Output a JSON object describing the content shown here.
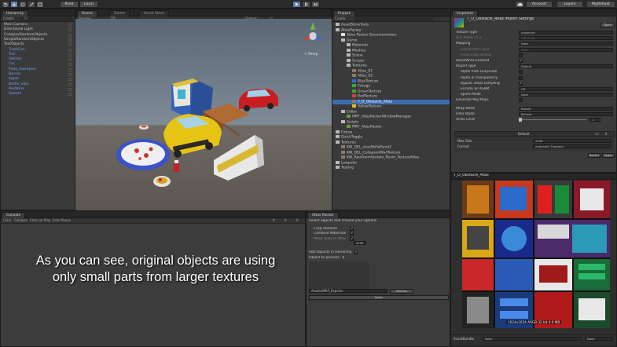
{
  "toolbar": {
    "pivot": "Pivot",
    "local": "Local",
    "account": "Account",
    "layers": "Layers",
    "layout": "MyDefault"
  },
  "hierarchy": {
    "tab": "Hierarchy",
    "create": "Create",
    "search_placeholder": "All",
    "items": [
      {
        "label": "Main Camera",
        "style": ""
      },
      {
        "label": "Directional Light",
        "style": ""
      },
      {
        "label": "ComplexRandomObjects",
        "style": ""
      },
      {
        "label": "SimpleRandomObjects",
        "style": ""
      },
      {
        "label": "TestObjects",
        "style": ""
      },
      {
        "label": "TrashCan",
        "style": "blue"
      },
      {
        "label": "Taxi",
        "style": "blue"
      },
      {
        "label": "Vehicle",
        "style": "blue"
      },
      {
        "label": "Car",
        "style": "blue"
      },
      {
        "label": "Plate_Sweepers",
        "style": "blue"
      },
      {
        "label": "Barrier",
        "style": "blue"
      },
      {
        "label": "Apple",
        "style": "blue"
      },
      {
        "label": "Bottle_alba",
        "style": "blue"
      },
      {
        "label": "RedWine",
        "style": "blue"
      },
      {
        "label": "Sweets",
        "style": "blue"
      }
    ]
  },
  "scene": {
    "tabs": [
      "Scene",
      "Game",
      "Asset Store"
    ],
    "shading": "Shaded",
    "mode": "2D",
    "gizmos": "Gizmos",
    "search": "All",
    "persp": "< Persp"
  },
  "project": {
    "tab": "Project",
    "create": "Create",
    "items": [
      {
        "label": "AssetStoreTools",
        "depth": 0,
        "icon": "folder",
        "selected": false
      },
      {
        "label": "AtlasPacker",
        "depth": 0,
        "icon": "folder",
        "selected": false
      },
      {
        "label": "Atlas Packer Documentation",
        "depth": 1,
        "icon": "doc",
        "selected": false
      },
      {
        "label": "Demo",
        "depth": 1,
        "icon": "folder",
        "selected": false
      },
      {
        "label": "Materials",
        "depth": 2,
        "icon": "folder",
        "selected": false
      },
      {
        "label": "Meshes",
        "depth": 2,
        "icon": "folder",
        "selected": false
      },
      {
        "label": "Scene",
        "depth": 2,
        "icon": "folder",
        "selected": false
      },
      {
        "label": "Scripts",
        "depth": 2,
        "icon": "folder",
        "selected": false
      },
      {
        "label": "Textures",
        "depth": 2,
        "icon": "folder",
        "selected": false
      },
      {
        "label": "Atlas_01",
        "depth": 3,
        "icon": "tex",
        "selected": false
      },
      {
        "label": "Atlas_02",
        "depth": 3,
        "icon": "tex",
        "selected": false
      },
      {
        "label": "BlueTexture",
        "depth": 3,
        "icon": "blue",
        "selected": false
      },
      {
        "label": "Foliage",
        "depth": 3,
        "icon": "green",
        "selected": false
      },
      {
        "label": "GreenTexture",
        "depth": 3,
        "icon": "green",
        "selected": false
      },
      {
        "label": "RedTexture",
        "depth": 3,
        "icon": "red",
        "selected": false
      },
      {
        "label": "T_O_Obstacle_Atlas",
        "depth": 3,
        "icon": "tex",
        "selected": true
      },
      {
        "label": "YellowTexture",
        "depth": 3,
        "icon": "yellow",
        "selected": false
      },
      {
        "label": "Editor",
        "depth": 1,
        "icon": "folder",
        "selected": false
      },
      {
        "label": "MRF_AtlasPackerWindowManager",
        "depth": 2,
        "icon": "cs",
        "selected": false
      },
      {
        "label": "Scripts",
        "depth": 1,
        "icon": "folder",
        "selected": false
      },
      {
        "label": "MRF_AtlasPacker",
        "depth": 2,
        "icon": "cs",
        "selected": false
      },
      {
        "label": "Extras",
        "depth": 0,
        "icon": "folder",
        "selected": false
      },
      {
        "label": "QuickToggle",
        "depth": 0,
        "icon": "folder",
        "selected": false
      },
      {
        "label": "Textures",
        "depth": 0,
        "icon": "folder",
        "selected": false
      },
      {
        "label": "KW_DEL_charSkillsPanel2",
        "depth": 1,
        "icon": "tex",
        "selected": false
      },
      {
        "label": "KW_DEL_CollapsedWallTexture",
        "depth": 1,
        "icon": "tex",
        "selected": false
      },
      {
        "label": "KW_RainAnimUpdate_Room_TextureAtlas",
        "depth": 1,
        "icon": "tex",
        "selected": false
      },
      {
        "label": "Lowpoler",
        "depth": 0,
        "icon": "folder",
        "selected": false
      },
      {
        "label": "Testing",
        "depth": 0,
        "icon": "folder",
        "selected": false
      }
    ]
  },
  "inspector": {
    "tab": "Inspector",
    "title": "T_O_Obstacle_Atlas Import Settings",
    "open": "Open",
    "rows": [
      {
        "label": "Texture Type",
        "value": "Advanced",
        "kind": "field"
      },
      {
        "label": "Non Power of 2",
        "value": "ToNearest",
        "kind": "field",
        "dim": true
      },
      {
        "label": "Mapping",
        "value": "None",
        "kind": "field"
      },
      {
        "label": "Convolution Type",
        "value": "None",
        "kind": "field",
        "dim": true,
        "indent": true
      },
      {
        "label": "Fixup Edge Seams",
        "value": "",
        "kind": "check",
        "dim": true,
        "indent": true
      },
      {
        "label": "Read/Write Enabled",
        "value": "✓",
        "kind": "check"
      },
      {
        "label": "Import Type",
        "value": "Default",
        "kind": "field"
      },
      {
        "label": "Alpha from Grayscale",
        "value": "",
        "kind": "check",
        "indent": true
      },
      {
        "label": "Alpha is Transparency",
        "value": "",
        "kind": "check",
        "indent": true
      },
      {
        "label": "Bypass sRGB Sampling",
        "value": "✓",
        "kind": "check",
        "indent": true
      },
      {
        "label": "Encode as RGBM",
        "value": "Off",
        "kind": "field",
        "indent": true
      },
      {
        "label": "Sprite Mode",
        "value": "None",
        "kind": "field",
        "indent": true
      },
      {
        "label": "Generate Mip Maps",
        "value": "",
        "kind": "check"
      },
      {
        "label": "",
        "value": "",
        "kind": "gap"
      },
      {
        "label": "Wrap Mode",
        "value": "Repeat",
        "kind": "field"
      },
      {
        "label": "Filter Mode",
        "value": "Bilinear",
        "kind": "field"
      },
      {
        "label": "Aniso Level",
        "value": "1",
        "kind": "slider"
      }
    ],
    "platform_default": "Default",
    "max_size_label": "Max Size",
    "max_size_value": "2048",
    "format_label": "Format",
    "format_value": "Automatic Truecolor",
    "revert": "Revert",
    "apply": "Apply"
  },
  "preview": {
    "title": "T_O_Obstacle_Atlas",
    "footer": "1024x1024  ARGB 32 bit  4.0 MB",
    "assetbundle_label": "AssetBundle",
    "assetbundle_value": "None",
    "assetbundle_variant": "None"
  },
  "console": {
    "tab": "Console",
    "buttons": [
      "Clear",
      "Collapse",
      "Clear on Play",
      "Error Pause"
    ],
    "counts": [
      "0",
      "0",
      "0"
    ]
  },
  "atlas_packer": {
    "tab": "Atlas Packer",
    "intro": "Select objects and choose your options",
    "options": [
      {
        "label": "Crop Textures",
        "checked": "✓"
      },
      {
        "label": "Combine Materials",
        "checked": "✓"
      },
      {
        "label": "Make Texture Atlas",
        "checked": "✓"
      }
    ],
    "max_size": "4096",
    "add_objects_label": "Add Objects in Heirarchy",
    "add_objects_checked": "✓",
    "objects_label": "Object to process : 0",
    "export_path": "Assets/MRF_Exports",
    "browse": "Browse",
    "apply": "Apply"
  },
  "caption": {
    "line1": "As you can see, original objects are using",
    "line2": "only small parts from larger textures"
  }
}
